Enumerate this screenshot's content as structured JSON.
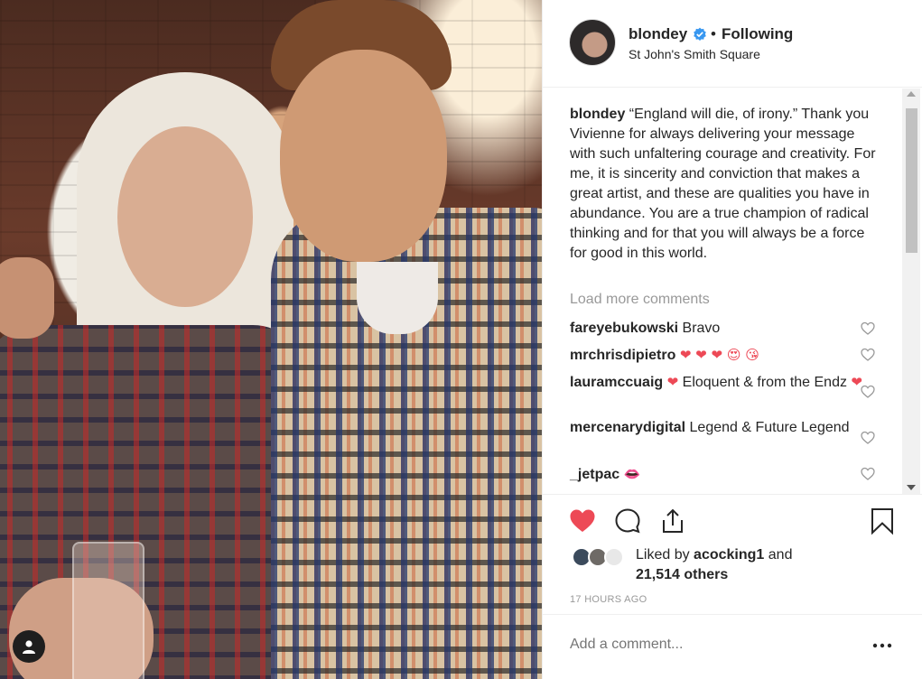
{
  "post": {
    "username": "blondey",
    "follow_status": "Following",
    "separator": "•",
    "location": "St John's Smith Square",
    "caption_user": "blondey",
    "caption_text": "“England will die, of irony.” Thank you Vivienne for always delivering your message with such unfaltering courage and creativity. For me, it is sincerity and conviction that makes a great artist, and these are qualities you have in abundance. You are a true champion of radical thinking and for that you will always be a force for good in this world.",
    "load_more": "Load more comments",
    "comments": [
      {
        "user": "fareyebukowski",
        "text": "Bravo",
        "emoji": ""
      },
      {
        "user": "mrchrisdipietro",
        "text": "",
        "emoji": "❤ ❤ ❤ 😍 😘"
      },
      {
        "user": "lauramccuaig",
        "text": "Eloquent & from the Endz",
        "emoji_before": "❤",
        "emoji_after": "❤"
      },
      {
        "user": "mercenarydigital",
        "text": "Legend & Future Legend",
        "emoji": ""
      },
      {
        "user": "_jetpac",
        "text": "",
        "emoji": "👄"
      }
    ],
    "liked_by_prefix": "Liked by",
    "liked_by_user": "acocking1",
    "liked_by_and": "and",
    "liked_by_others": "21,514 others",
    "timestamp": "17 HOURS AGO",
    "add_comment_placeholder": "Add a comment...",
    "more_label": "•••"
  },
  "colors": {
    "like_red": "#ed4956",
    "verified_blue": "#3897f0",
    "muted_text": "#999999"
  },
  "icons": [
    "verified-badge-icon",
    "heart-icon",
    "comment-icon",
    "share-icon",
    "bookmark-icon",
    "more-options-icon",
    "account-icon"
  ]
}
